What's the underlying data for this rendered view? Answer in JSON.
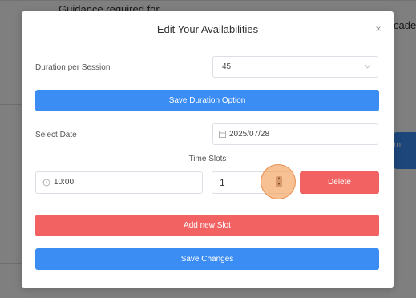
{
  "background": {
    "text_top": "Guidance required for",
    "text_right": "cader",
    "button_text": "m"
  },
  "modal": {
    "title": "Edit Your Availabilities",
    "close": "×",
    "duration": {
      "label": "Duration per Session",
      "value": "45"
    },
    "save_duration_label": "Save Duration Option",
    "date": {
      "label": "Select Date",
      "value": "2025/07/28"
    },
    "time_slots_label": "Time Slots",
    "slot": {
      "time": "10:00",
      "quantity": "1",
      "delete_label": "Delete"
    },
    "add_slot_label": "Add new Slot",
    "save_changes_label": "Save Changes"
  },
  "icons": {
    "chevron": "chevron-down-icon",
    "calendar": "calendar-icon",
    "clock": "clock-icon",
    "close": "close-icon",
    "stepper": "stepper-icon"
  },
  "colors": {
    "primary": "#3b8df4",
    "danger": "#f26262",
    "cursor_highlight": "#f5a05a"
  }
}
